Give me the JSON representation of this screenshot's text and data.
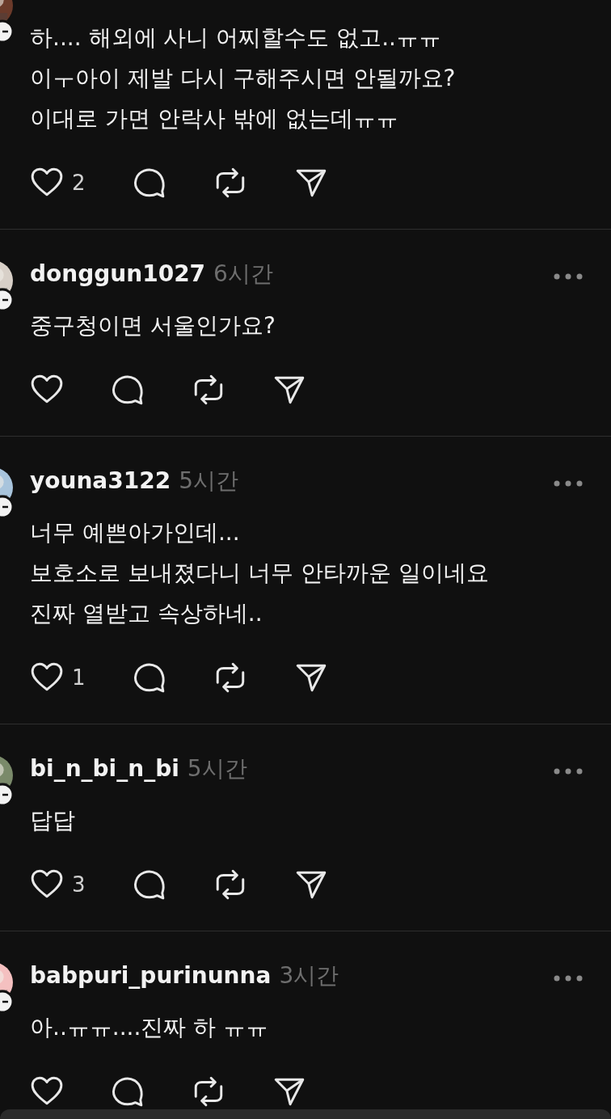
{
  "comments": [
    {
      "lines": [
        "하.... 해외에 사니 어찌할수도 없고..ㅠㅠ",
        "이ㅜ아이 제발 다시 구해주시면 안될까요?",
        "이대로 가면 안락사 밖에 없는데ㅠㅠ"
      ],
      "likes": "2"
    },
    {
      "username": "donggun1027",
      "time": "6시간",
      "lines": [
        "중구청이면 서울인가요?"
      ]
    },
    {
      "username": "youna3122",
      "time": "5시간",
      "lines": [
        "너무 예쁜아가인데...",
        "보호소로 보내졌다니 너무 안타까운 일이네요",
        "진짜 열받고 속상하네.."
      ],
      "likes": "1"
    },
    {
      "username": "bi_n_bi_n_bi",
      "time": "5시간",
      "lines": [
        "답답"
      ],
      "likes": "3"
    },
    {
      "username": "babpuri_purinunna",
      "time": "3시간",
      "lines": [
        "아..ㅠㅠ....진짜 하 ㅠㅠ"
      ]
    }
  ]
}
